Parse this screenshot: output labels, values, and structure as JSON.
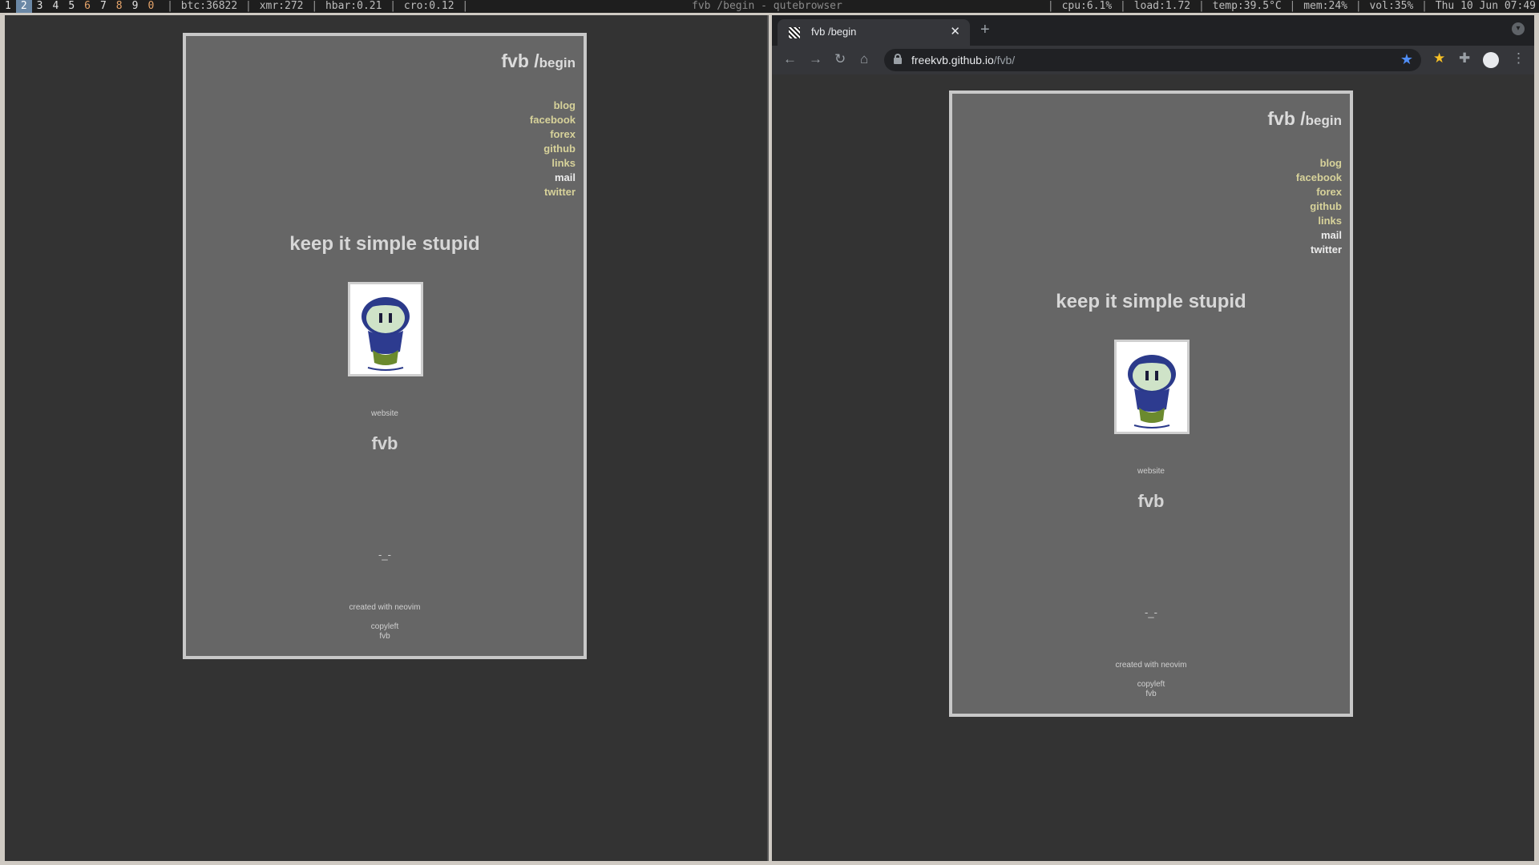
{
  "statusbar": {
    "workspaces": [
      "1",
      "2",
      "3",
      "4",
      "5",
      "6",
      "7",
      "8",
      "9",
      "0"
    ],
    "active_workspace": "2",
    "tickers": [
      "btc:36822",
      "xmr:272",
      "hbar:0.21",
      "cro:0.12"
    ],
    "window_title": "fvb /begin - qutebrowser",
    "stats": [
      "cpu:6.1%",
      "load:1.72",
      "temp:39.5°C",
      "mem:24%",
      "vol:35%"
    ],
    "datetime": "Thu 10 Jun  07:49",
    "separator": "|"
  },
  "browser": {
    "tab_title": "fvb /begin",
    "tab_close": "✕",
    "new_tab": "+",
    "url_host": "freekvb.github.io",
    "url_path": "/fvb/",
    "icons": [
      "back-icon",
      "forward-icon",
      "reload-icon",
      "home-icon",
      "lock-icon",
      "star-icon",
      "bookmark-icon",
      "extensions-icon",
      "profile-icon",
      "menu-icon"
    ]
  },
  "page": {
    "title_main": "fvb /",
    "title_sub": "begin",
    "nav": [
      {
        "label": "blog"
      },
      {
        "label": "facebook"
      },
      {
        "label": "forex"
      },
      {
        "label": "github"
      },
      {
        "label": "links"
      },
      {
        "label": "mail"
      },
      {
        "label": "twitter"
      }
    ],
    "motto": "keep it simple stupid",
    "website_label": "website",
    "big_name": "fvb",
    "face": "-_-",
    "created": "created with neovim",
    "copyleft": "copyleft",
    "copyleft_name": "fvb"
  },
  "colors": {
    "card_bg": "#666666",
    "link_yellow": "#d7d29a",
    "link_white": "#ececec",
    "pane_bg": "#333333",
    "active_ws": "#6b88a6"
  }
}
